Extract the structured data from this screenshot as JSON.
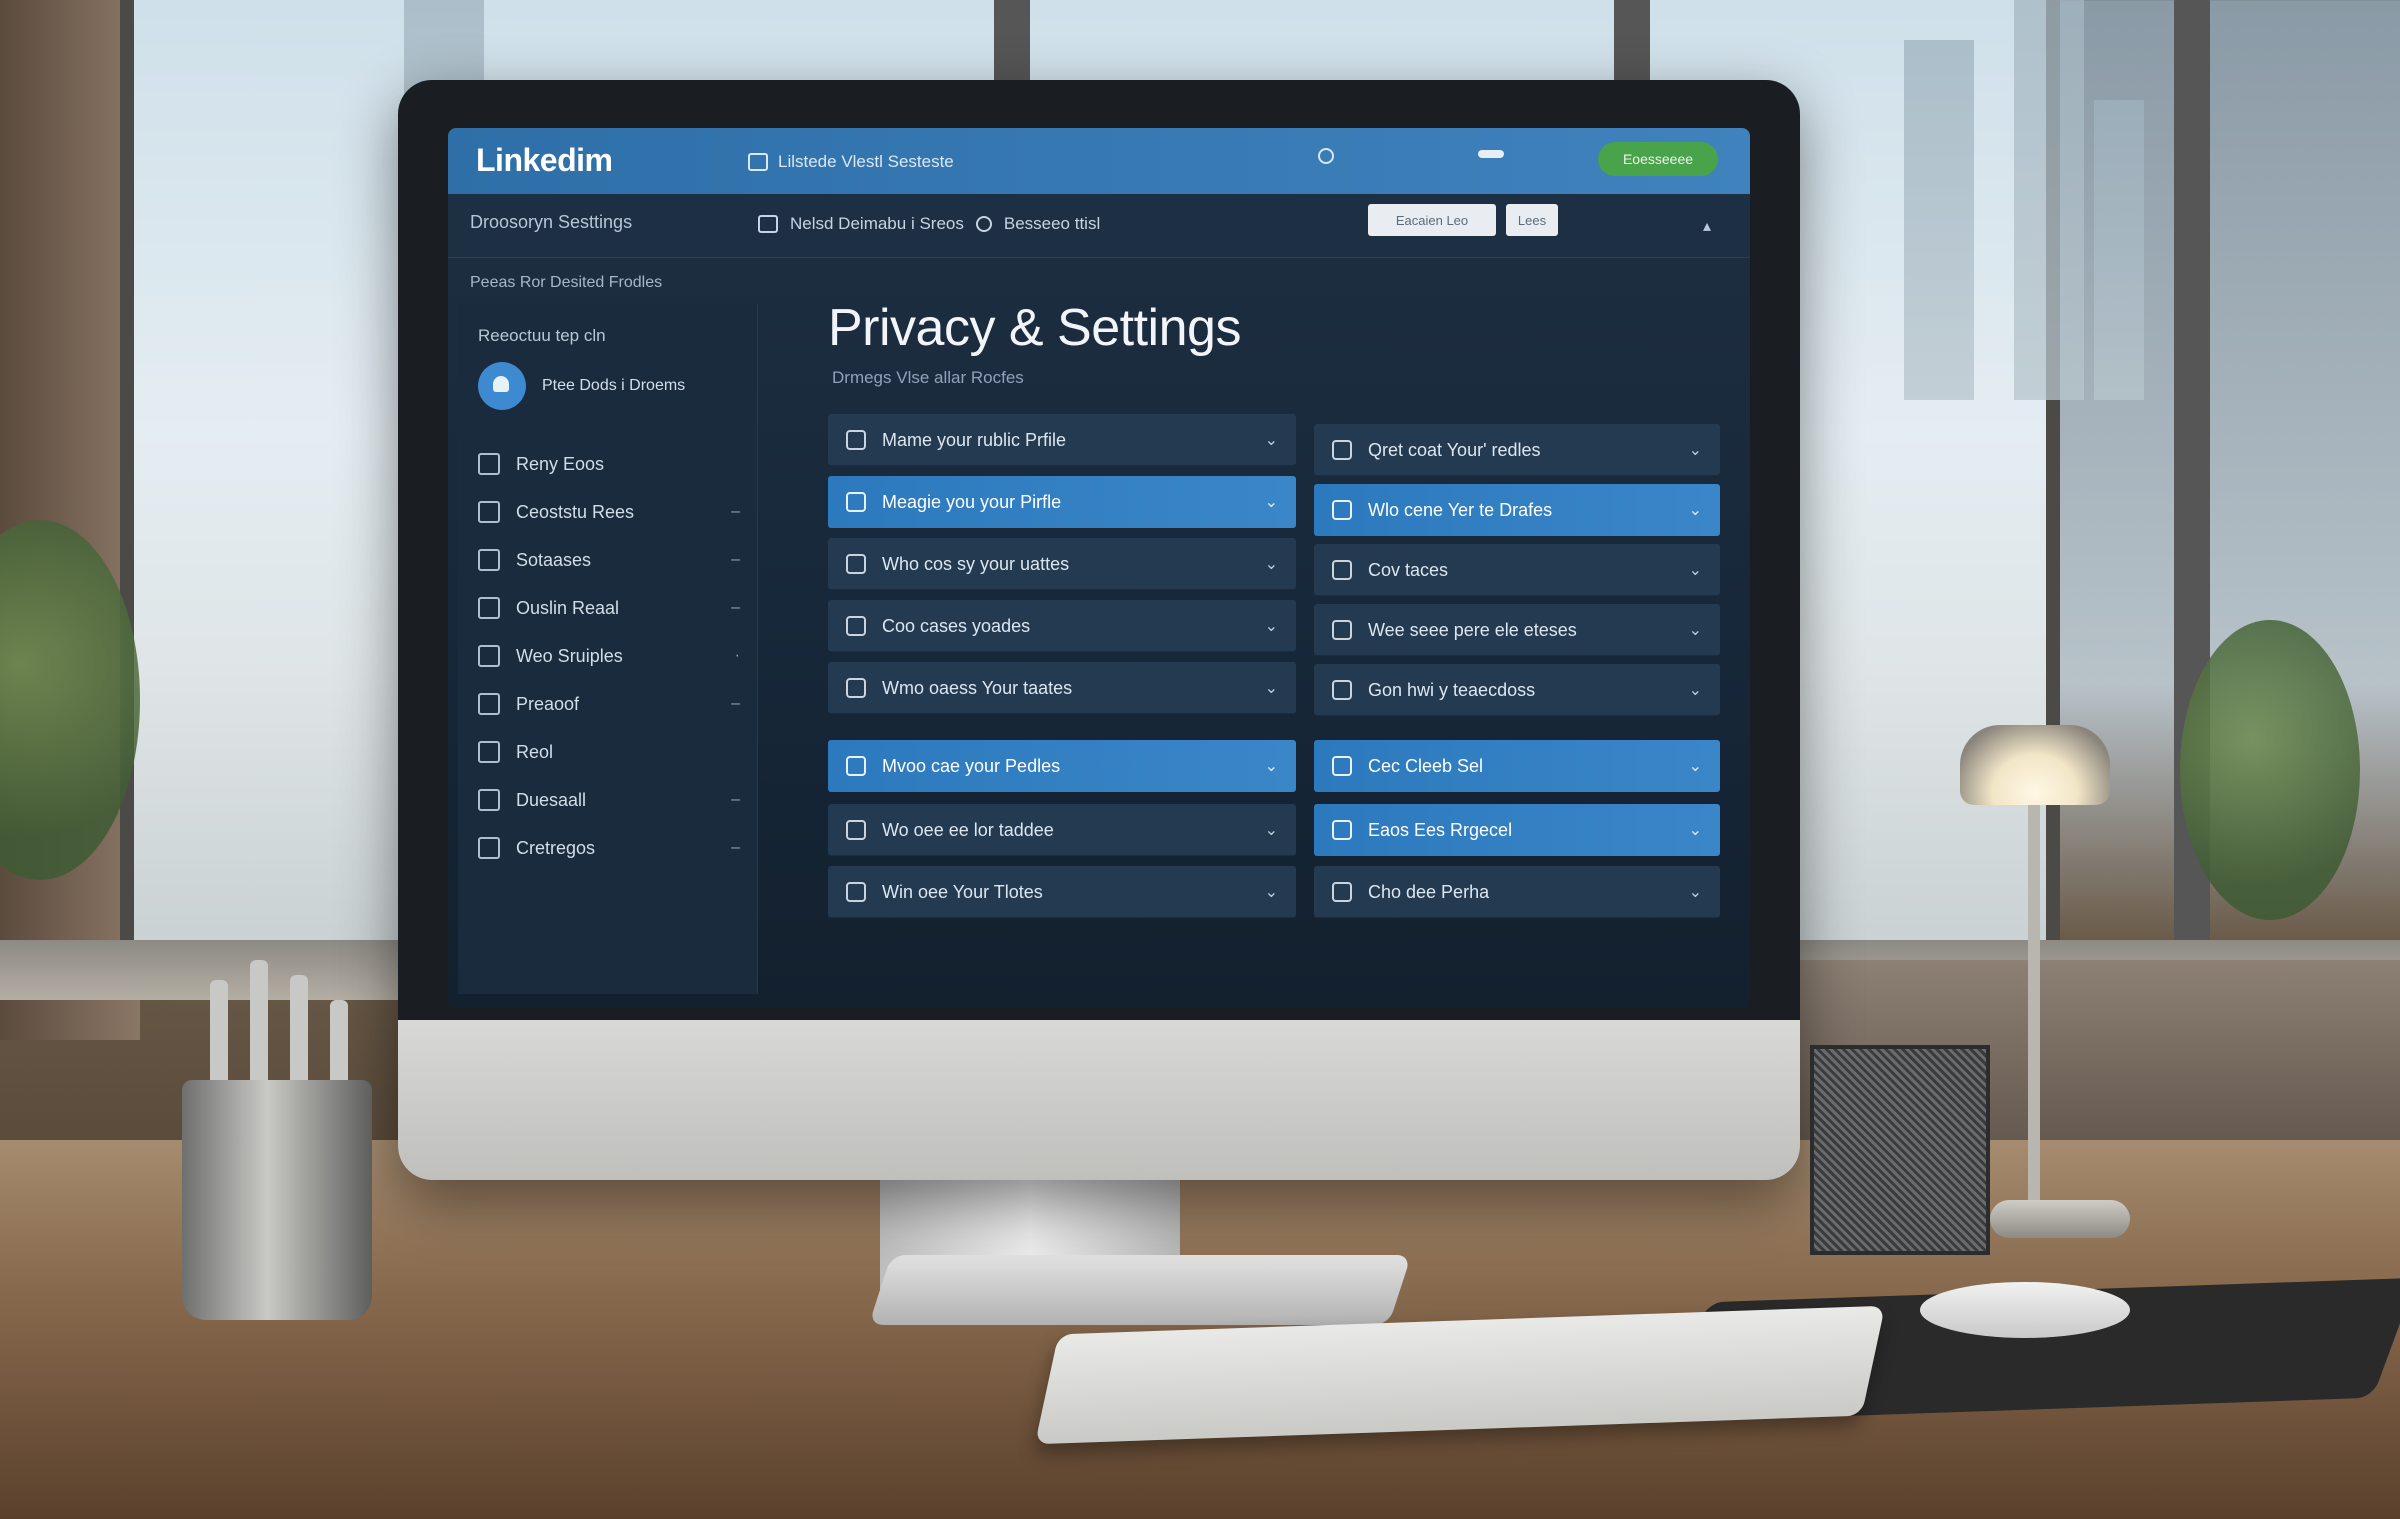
{
  "app": {
    "logo": "Linkedim",
    "topbar_search": "Lilstede Vlestl Sesteste",
    "topbar_green_button": "Eoesseeee"
  },
  "subbar": {
    "left_title": "Droosoryn Sesttings",
    "mid_item_1": "Nelsd Deimabu i Sreos",
    "mid_item_2": "Besseeo ttisl",
    "button_1": "Eacaien Leo",
    "button_2": "Lees"
  },
  "breadcrumb": "Peeas Ror Desited Frodles",
  "sidebar": {
    "heading": "Reeoctuu tep cln",
    "profile_label": "Ptee Dods i Droems",
    "items": [
      {
        "label": "Reny Eoos",
        "icon": "share-icon",
        "dash": ""
      },
      {
        "label": "Ceoststu Rees",
        "icon": "grid-icon",
        "dash": "–"
      },
      {
        "label": "Sotaases",
        "icon": "network-icon",
        "dash": "–"
      },
      {
        "label": "Ouslin Reaal",
        "icon": "chart-icon",
        "dash": "–"
      },
      {
        "label": "Weo Sruiples",
        "icon": "doc-icon",
        "dash": "·"
      },
      {
        "label": "Preaoof",
        "icon": "square-icon",
        "dash": "–"
      },
      {
        "label": "Reol",
        "icon": "lock-icon",
        "dash": ""
      },
      {
        "label": "Duesaall",
        "icon": "list-icon",
        "dash": "–"
      },
      {
        "label": "Cretregos",
        "icon": "table-icon",
        "dash": "–"
      }
    ]
  },
  "main": {
    "title": "Privacy & Settings",
    "subtitle": "Drmegs Vlse allar Rocfes",
    "left_rows": [
      {
        "label": "Mame your rublic Prfile",
        "state": "dark"
      },
      {
        "label": "Meagie you your Pirfle",
        "state": "blue"
      },
      {
        "label": "Who cos sy your uattes",
        "state": "dark"
      },
      {
        "label": "Coo cases yoades",
        "state": "dark"
      },
      {
        "label": "Wmo oaess Your taates",
        "state": "dark"
      },
      {
        "label": "Mvoo cae your Pedles",
        "state": "blue"
      },
      {
        "label": "Wo oee ee lor taddee",
        "state": "dark"
      },
      {
        "label": "Win oee Your Tlotes",
        "state": "dark"
      }
    ],
    "right_rows": [
      {
        "label": "Qret coat Your' redles",
        "state": "dark"
      },
      {
        "label": "Wlo cene Yer te Drafes",
        "state": "blue"
      },
      {
        "label": "Cov taces",
        "state": "dark"
      },
      {
        "label": "Wee seee pere ele eteses",
        "state": "dark"
      },
      {
        "label": "Gon hwi y teaecdoss",
        "state": "dark"
      },
      {
        "label": "Cec Cleeb Sel",
        "state": "blue"
      },
      {
        "label": "Eaos Ees Rrgecel",
        "state": "blue"
      },
      {
        "label": "Cho dee Perha",
        "state": "dark"
      }
    ]
  },
  "colors": {
    "topbar": "#2e6fa8",
    "screen_bg": "#1f2f42",
    "row_dark": "#243a51",
    "row_blue": "#2c79bd",
    "green_button": "#49a34a"
  }
}
